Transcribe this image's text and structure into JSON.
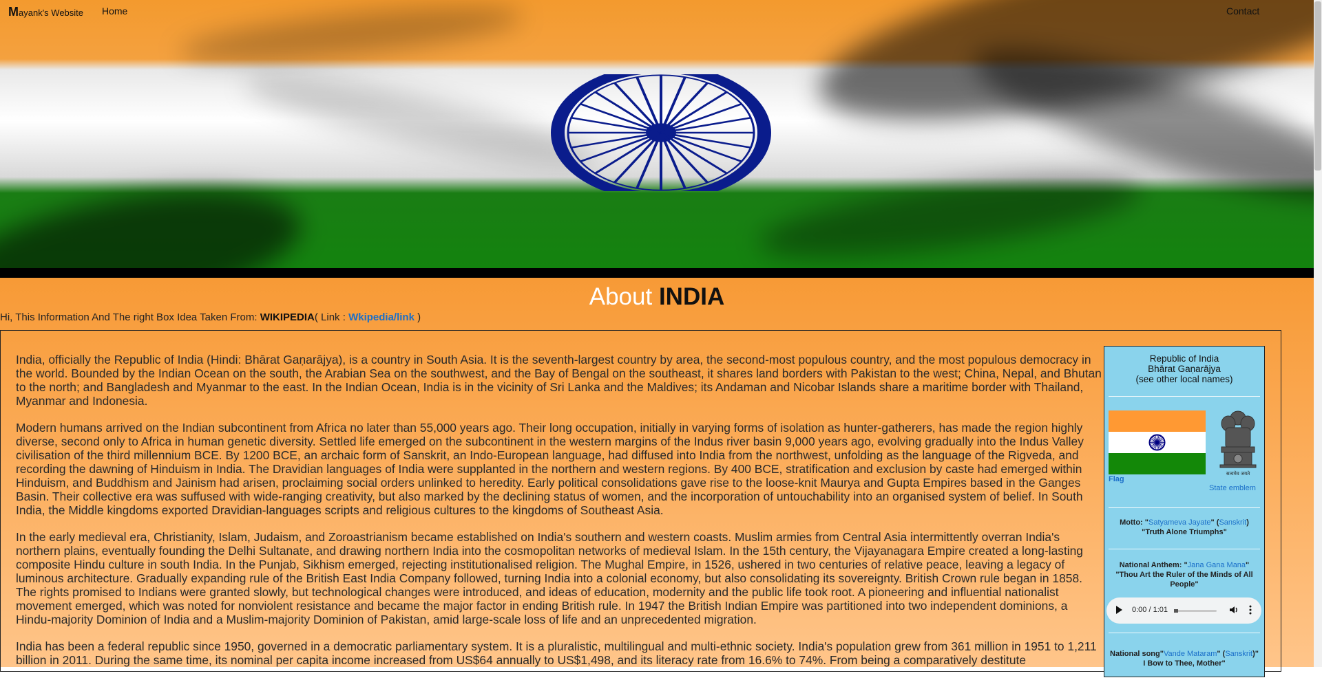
{
  "nav": {
    "brand_initial": "M",
    "brand_rest": "ayank's Website",
    "home": "Home",
    "contact": "Contact"
  },
  "hero": {
    "image": "india-flag-waving",
    "chakra_color": "#0a1c8c"
  },
  "about": {
    "title_prefix": "About",
    "title_strong": "INDIA",
    "credit_pre": "Hi, This Information And The right Box Idea Taken From:",
    "credit_source": "WIKIPEDIA",
    "credit_link_open": "( Link :",
    "credit_link": "Wkipedia/link",
    "credit_link_close": ")"
  },
  "article": {
    "paragraphs": [
      "India, officially the Republic of India (Hindi: Bhārat Gaṇarājya), is a country in South Asia. It is the seventh-largest country by area, the second-most populous country, and the most populous democracy in the world. Bounded by the Indian Ocean on the south, the Arabian Sea on the southwest, and the Bay of Bengal on the southeast, it shares land borders with Pakistan to the west; China, Nepal, and Bhutan to the north; and Bangladesh and Myanmar to the east. In the Indian Ocean, India is in the vicinity of Sri Lanka and the Maldives; its Andaman and Nicobar Islands share a maritime border with Thailand, Myanmar and Indonesia.",
      "Modern humans arrived on the Indian subcontinent from Africa no later than 55,000 years ago. Their long occupation, initially in varying forms of isolation as hunter-gatherers, has made the region highly diverse, second only to Africa in human genetic diversity. Settled life emerged on the subcontinent in the western margins of the Indus river basin 9,000 years ago, evolving gradually into the Indus Valley civilisation of the third millennium BCE. By 1200 BCE, an archaic form of Sanskrit, an Indo-European language, had diffused into India from the northwest, unfolding as the language of the Rigveda, and recording the dawning of Hinduism in India. The Dravidian languages of India were supplanted in the northern and western regions. By 400 BCE, stratification and exclusion by caste had emerged within Hinduism, and Buddhism and Jainism had arisen, proclaiming social orders unlinked to heredity. Early political consolidations gave rise to the loose-knit Maurya and Gupta Empires based in the Ganges Basin. Their collective era was suffused with wide-ranging creativity, but also marked by the declining status of women, and the incorporation of untouchability into an organised system of belief. In South India, the Middle kingdoms exported Dravidian-languages scripts and religious cultures to the kingdoms of Southeast Asia.",
      "In the early medieval era, Christianity, Islam, Judaism, and Zoroastrianism became established on India's southern and western coasts. Muslim armies from Central Asia intermittently overran India's northern plains, eventually founding the Delhi Sultanate, and drawing northern India into the cosmopolitan networks of medieval Islam. In the 15th century, the Vijayanagara Empire created a long-lasting composite Hindu culture in south India. In the Punjab, Sikhism emerged, rejecting institutionalised religion. The Mughal Empire, in 1526, ushered in two centuries of relative peace, leaving a legacy of luminous architecture. Gradually expanding rule of the British East India Company followed, turning India into a colonial economy, but also consolidating its sovereignty. British Crown rule began in 1858. The rights promised to Indians were granted slowly, but technological changes were introduced, and ideas of education, modernity and the public life took root. A pioneering and influential nationalist movement emerged, which was noted for nonviolent resistance and became the major factor in ending British rule. In 1947 the British Indian Empire was partitioned into two independent dominions, a Hindu-majority Dominion of India and a Muslim-majority Dominion of Pakistan, amid large-scale loss of life and an unprecedented migration.",
      "India has been a federal republic since 1950, governed in a democratic parliamentary system. It is a pluralistic, multilingual and multi-ethnic society. India's population grew from 361 million in 1951 to 1,211 billion in 2011. During the same time, its nominal per capita income increased from US$64 annually to US$1,498, and its literacy rate from 16.6% to 74%. From being a comparatively destitute"
    ]
  },
  "infobox": {
    "title_lines": [
      "Republic of India",
      "Bhārat Gaṇarājya",
      "(see other local names)"
    ],
    "flag_caption": "Flag",
    "emblem_motto": "सत्यमेव जयते",
    "emblem_caption": "State emblem",
    "motto_label": "Motto: \"",
    "motto_link": "Satyameva Jayate",
    "motto_mid": "\" (",
    "motto_lang": "Sanskrit",
    "motto_end": ")",
    "motto_translation": "\"Truth Alone Triumphs\"",
    "anthem_label": "National Anthem: \"",
    "anthem_link": "Jana Gana Mana",
    "anthem_end": "\"",
    "anthem_translation": "\"Thou Art the Ruler of the Minds of All People\"",
    "audio_time": "0:00 / 1:01",
    "audio_progress": 0,
    "song_label": "National song\"",
    "song_link": "Vande Mataram",
    "song_mid": "\" (",
    "song_lang": "Sanskrit",
    "song_end": ")\"",
    "song_translation": "I Bow to Thee, Mother\""
  }
}
